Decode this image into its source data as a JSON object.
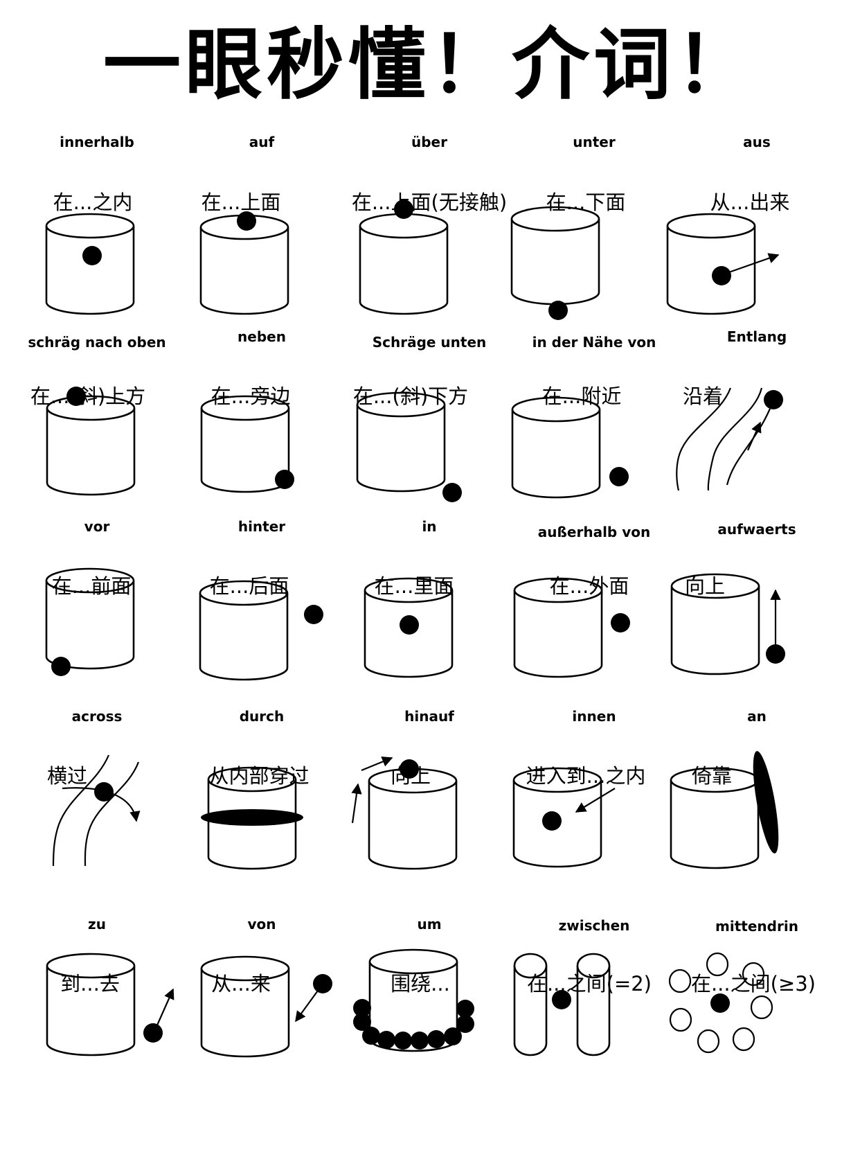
{
  "title": "一眼秒懂！介词！",
  "colors": {
    "ink": "#000000",
    "paper": "#ffffff"
  },
  "prepositions": [
    {
      "word": "innerhalb",
      "meaning": "在...之内",
      "icon": "ball-inside-cylinder"
    },
    {
      "word": "auf",
      "meaning": "在...上面",
      "icon": "ball-on-top-cylinder"
    },
    {
      "word": "über",
      "meaning": "在...上面(无接触)",
      "icon": "ball-above-cylinder"
    },
    {
      "word": "unter",
      "meaning": "在...下面",
      "icon": "ball-below-cylinder"
    },
    {
      "word": "aus",
      "meaning": "从...出来",
      "icon": "ball-exiting-cylinder"
    },
    {
      "word": "schräg nach oben",
      "meaning": "在...(斜)上方",
      "icon": "ball-upper-left-cylinder"
    },
    {
      "word": "neben",
      "meaning": "在...旁边",
      "icon": "ball-beside-cylinder"
    },
    {
      "word": "Schräge unten",
      "meaning": "在...(斜)下方",
      "icon": "ball-lower-right-cylinder"
    },
    {
      "word": "in der Nähe von",
      "meaning": "在...附近",
      "icon": "ball-near-cylinder"
    },
    {
      "word": "Entlang",
      "meaning": "沿着",
      "icon": "ball-along-path"
    },
    {
      "word": "vor",
      "meaning": "在...前面",
      "icon": "ball-front-cylinder"
    },
    {
      "word": "hinter",
      "meaning": "在...后面",
      "icon": "ball-behind-cylinder"
    },
    {
      "word": "in",
      "meaning": "在...里面",
      "icon": "ball-in-cylinder"
    },
    {
      "word": "außerhalb von",
      "meaning": "在...外面",
      "icon": "ball-outside-cylinder"
    },
    {
      "word": "aufwaerts",
      "meaning": "向上",
      "icon": "ball-moving-upward"
    },
    {
      "word": "across",
      "meaning": "横过",
      "icon": "ball-crossing-path"
    },
    {
      "word": "durch",
      "meaning": "从内部穿过",
      "icon": "disc-through-cylinder"
    },
    {
      "word": "hinauf",
      "meaning": "向上",
      "icon": "ball-climbing-cylinder"
    },
    {
      "word": "innen",
      "meaning": "进入到...之内",
      "icon": "ball-entering-cylinder"
    },
    {
      "word": "an",
      "meaning": "倚靠",
      "icon": "board-leaning-cylinder"
    },
    {
      "word": "zu",
      "meaning": "到...去",
      "icon": "ball-toward-cylinder"
    },
    {
      "word": "von",
      "meaning": "从...来",
      "icon": "ball-from-cylinder"
    },
    {
      "word": "um",
      "meaning": "围绕...",
      "icon": "balls-around-cylinder"
    },
    {
      "word": "zwischen",
      "meaning": "在...之间(=2)",
      "icon": "ball-between-two-pillars"
    },
    {
      "word": "mittendrin",
      "meaning": "在...之间(≥3)",
      "icon": "ball-among-circles"
    }
  ]
}
